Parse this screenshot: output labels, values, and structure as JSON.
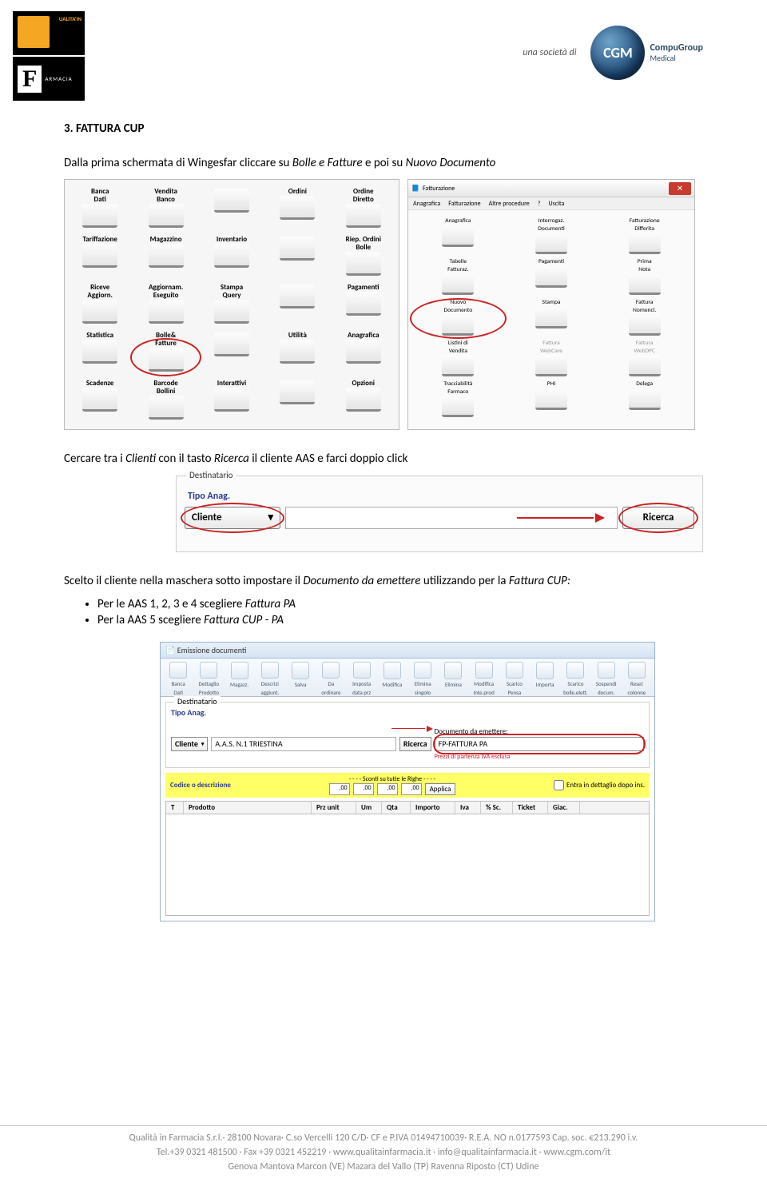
{
  "header": {
    "una_societa": "una società di",
    "cgm_brand_top": "CompuGroup",
    "cgm_brand_bot": "Medical",
    "cgm_abbr": "CGM",
    "qualita_top": "UALITA'IN",
    "qualita_bot": "ARMACIA"
  },
  "section_title": "3.  FATTURA CUP",
  "para1": "Dalla prima schermata di Wingesfar cliccare su Bolle e Fatture e poi su Nuovo Documento",
  "panelA": {
    "items": [
      [
        "Banca\nDati",
        "Vendita\nBanco",
        "",
        "Ordini",
        "Ordine\nDiretto"
      ],
      [
        "Tariffazione",
        "Magazzino",
        "Inventario",
        "",
        "Riep. Ordini\nBolle"
      ],
      [
        "Riceve\nAggiorn.",
        "Aggiornam.\nEseguito",
        "Stampa\nQuery",
        "",
        "Pagamenti"
      ],
      [
        "Statistica",
        "Bolle&\nFatture",
        "",
        "Utilità",
        "Anagrafica"
      ],
      [
        "Scadenze",
        "Barcode\nBollini",
        "Interattivi",
        "",
        "Opzioni"
      ]
    ],
    "circled_label": "Bolle&\nFatture"
  },
  "panelB": {
    "title": "Fatturazione",
    "menu": [
      "Anagrafica",
      "Fatturazione",
      "Altre procedure",
      "?",
      "Uscita"
    ],
    "items": [
      [
        "Anagrafica",
        "Interrogaz.\nDocumenti",
        "Fatturazione\nDifferita"
      ],
      [
        "Tabelle\nFatturaz.",
        "Pagamenti",
        "Prima\nNota"
      ],
      [
        "Nuovo\nDocumento",
        "Stampa",
        "Fattura\nNomencl."
      ],
      [
        "Listini di\nVendita",
        "Fattura\nWebCare",
        "Fattura\nWebDPC"
      ],
      [
        "Tracciabilità\nFarmaco",
        "PHI",
        "Delega"
      ]
    ],
    "circled_label": "Nuovo\nDocumento"
  },
  "para2": "Cercare tra i Clienti con il tasto Ricerca il cliente AAS e farci doppio click",
  "dest_box": {
    "legend": "Destinatario",
    "tipo_label": "Tipo Anag.",
    "cliente_btn": "Cliente",
    "ricerca_btn": "Ricerca"
  },
  "para3_pre": "Scelto il cliente nella maschera sotto impostare il ",
  "para3_mid": "Documento da emettere",
  "para3_pst": " utilizzando per la ",
  "para3_end": "Fattura CUP",
  "bullets": [
    {
      "t1": "Per le AAS 1, 2, 3 e 4 scegliere ",
      "em": "Fattura PA"
    },
    {
      "t1": "Per la AAS 5 scegliere ",
      "em": "Fattura CUP - PA"
    }
  ],
  "emiss": {
    "title": "Emissione documenti",
    "ribbon": [
      "Banca\nDati",
      "Dettaglio\nProdotto",
      "Magazz.",
      "Descrizi\naggiunt.",
      "Salva",
      "Da\nordinare",
      "Imposta\ndata prz",
      "Modifica",
      "Elimina\nsingolo",
      "Elimina",
      "Modifica\nInte.prod",
      "Scarico\nPensa",
      "Importa",
      "Scarico\nbolle.elett.",
      "Sospendi\ndocum.",
      "Reset\ncolonne"
    ],
    "dest_legend": "Destinatario",
    "tipo_label": "Tipo Anag.",
    "cliente_btn": "Cliente",
    "cliente_val": "A.A.S. N.1 TRIESTINA",
    "ricerca_btn": "Ricerca",
    "doc_label": "Documento da emettere:",
    "doc_val": "FP-FATTURA PA",
    "iva_note": "Prezzi di partenza IVA esclusa",
    "yellow_label": "Codice o descrizione",
    "sconti_label": "- - - - Sconti su tutte le Righe - - - -",
    "num_vals": [
      ",00",
      ",00",
      ",00",
      ",00"
    ],
    "applica": "Applica",
    "entra_cb": "Entra in dettaglio dopo ins.",
    "table_cols": [
      "T",
      "Prodotto",
      "Prz unit",
      "Um",
      "Qta",
      "Importo",
      "Iva",
      "% Sc.",
      "Ticket",
      "Giac."
    ]
  },
  "footer": {
    "line1": "Qualità in Farmacia S.r.l.· 28100 Novara· C.so Vercelli 120 C/D· CF e P.IVA 01494710039· R.E.A. NO n.0177593 Cap. soc. €213.290 i.v.",
    "line2": "Tel.+39 0321 481500 · Fax +39 0321 452219 · www.qualitainfarmacia.it · info@qualitainfarmacia.it · www.cgm.com/it",
    "line3": "Genova    Mantova    Marcon (VE)   Mazara del Vallo (TP)    Ravenna    Riposto (CT)    Udine"
  }
}
